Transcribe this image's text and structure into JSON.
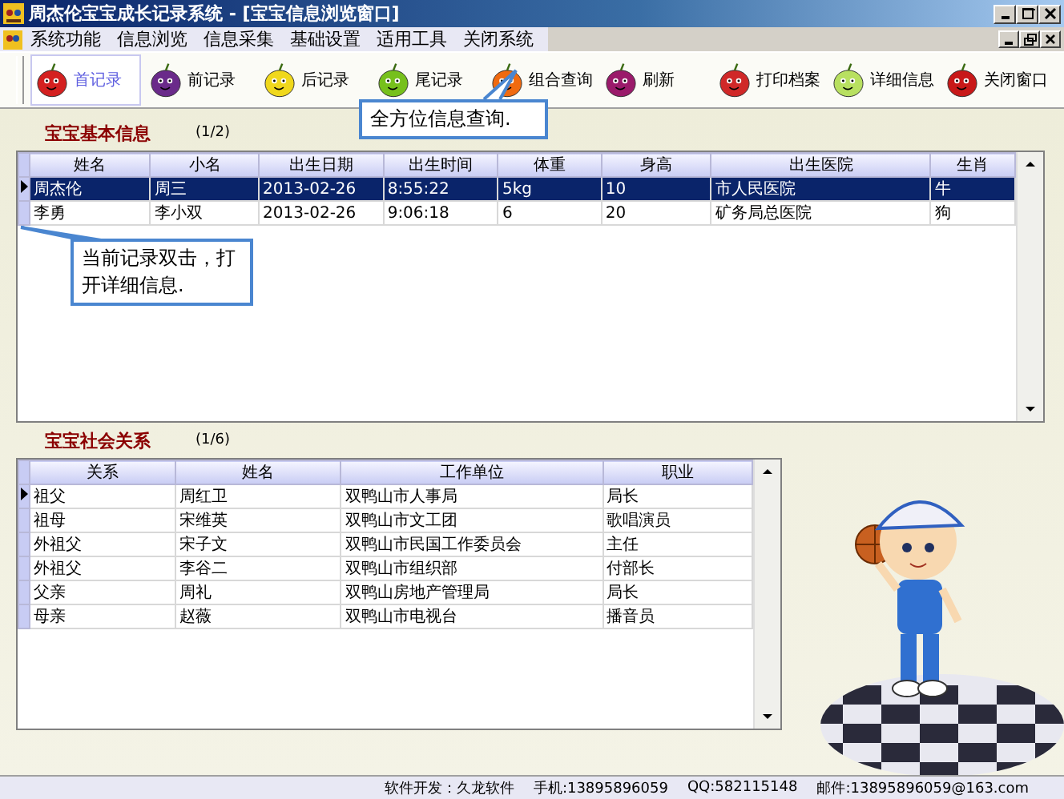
{
  "window": {
    "title": "周杰伦宝宝成长记录系统 - [宝宝信息浏览窗口]"
  },
  "menu": [
    "系统功能",
    "信息浏览",
    "信息采集",
    "基础设置",
    "适用工具",
    "关闭系统"
  ],
  "toolbar": [
    {
      "label": "首记录",
      "selected": true
    },
    {
      "label": "前记录",
      "selected": false
    },
    {
      "label": "后记录",
      "selected": false
    },
    {
      "label": "尾记录",
      "selected": false
    },
    {
      "label": "组合查询",
      "selected": false
    },
    {
      "label": "刷新",
      "selected": false
    },
    {
      "label": "打印档案",
      "selected": false
    },
    {
      "label": "详细信息",
      "selected": false
    },
    {
      "label": "关闭窗口",
      "selected": false
    }
  ],
  "callouts": [
    "全方位信息查询.",
    "当前记录双击，打开详细信息."
  ],
  "basic_info": {
    "title": "宝宝基本信息",
    "count": "(1/2)",
    "focused": true,
    "columns": [
      "姓名",
      "小名",
      "出生日期",
      "出生时间",
      "体重",
      "身高",
      "出生医院",
      "生肖"
    ],
    "rows": [
      {
        "selected": true,
        "cells": [
          "周杰伦",
          "周三",
          "2013-02-26",
          "8:55:22",
          "5kg",
          "10",
          "市人民医院",
          "牛"
        ]
      },
      {
        "selected": false,
        "cells": [
          "李勇",
          "李小双",
          "2013-02-26",
          "9:06:18",
          "6",
          "20",
          "矿务局总医院",
          "狗"
        ]
      }
    ]
  },
  "relations": {
    "title": "宝宝社会关系",
    "count": "(1/6)",
    "focused": false,
    "columns": [
      "关系",
      "姓名",
      "工作单位",
      "职业"
    ],
    "rows": [
      {
        "selected": true,
        "cells": [
          "祖父",
          "周红卫",
          "双鸭山市人事局",
          "局长"
        ]
      },
      {
        "selected": false,
        "cells": [
          "祖母",
          "宋维英",
          "双鸭山市文工团",
          "歌唱演员"
        ]
      },
      {
        "selected": false,
        "cells": [
          "外祖父",
          "宋子文",
          "双鸭山市民国工作委员会",
          "主任"
        ]
      },
      {
        "selected": false,
        "cells": [
          "外祖父",
          "李谷二",
          "双鸭山市组织部",
          "付部长"
        ]
      },
      {
        "selected": false,
        "cells": [
          "父亲",
          "周礼",
          "双鸭山房地产管理局",
          "局长"
        ]
      },
      {
        "selected": false,
        "cells": [
          "母亲",
          "赵薇",
          "双鸭山市电视台",
          "播音员"
        ]
      }
    ]
  },
  "status_bar": [
    "软件开发：久龙软件",
    "手机:13895896059",
    "QQ:582115148",
    "邮件:13895896059@163.com"
  ]
}
